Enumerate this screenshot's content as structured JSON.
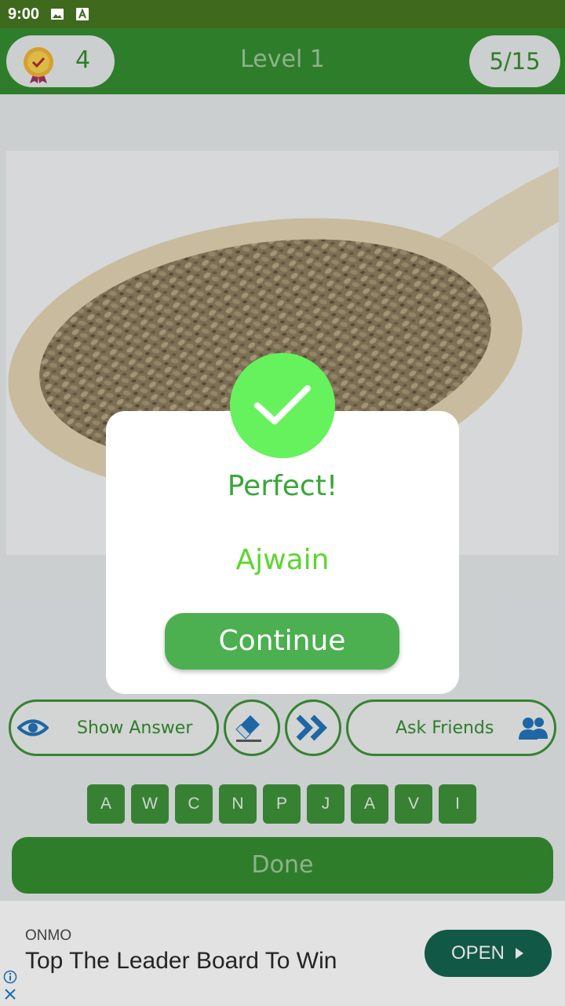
{
  "status_bar": {
    "time": "9:00"
  },
  "header": {
    "coins": "4",
    "level": "Level 1",
    "progress": "5/15"
  },
  "tools": {
    "show_answer": "Show Answer",
    "ask_friends": "Ask Friends"
  },
  "letters": [
    "A",
    "W",
    "C",
    "N",
    "P",
    "J",
    "A",
    "V",
    "I"
  ],
  "done_label": "Done",
  "ad": {
    "brand": "ONMO",
    "title": "Top The Leader Board To Win",
    "cta": "OPEN"
  },
  "dialog": {
    "title": "Perfect!",
    "answer": "Ajwain",
    "continue_label": "Continue"
  },
  "colors": {
    "primary_green": "#2f8a2a",
    "success_green": "#66f25c",
    "ad_button": "#0f5f4b"
  }
}
